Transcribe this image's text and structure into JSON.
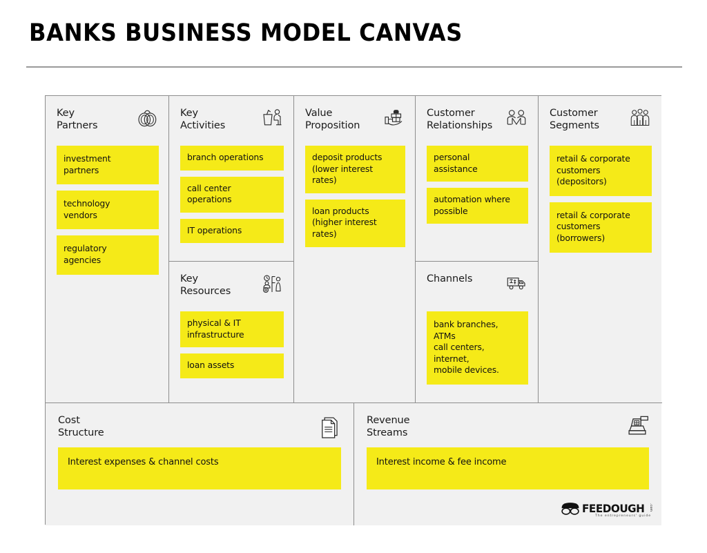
{
  "page": {
    "title": "BANKS BUSINESS MODEL CANVAS",
    "background_color": "#ffffff",
    "panel_color": "#f1f1f1",
    "note_color": "#F5EA18",
    "border_color": "#8d8d8d"
  },
  "blocks": {
    "key_partners": {
      "title": "Key\nPartners",
      "icon": "interlocking-rings-icon",
      "notes": [
        "investment\npartners",
        "technology\nvendors",
        "regulatory\nagencies"
      ]
    },
    "key_activities": {
      "title": "Key\nActivities",
      "icon": "person-at-desk-icon",
      "notes": [
        "branch operations",
        "call center\noperations",
        "IT operations"
      ]
    },
    "key_resources": {
      "title": "Key\nResources",
      "icon": "gears-clock-person-icon",
      "notes": [
        "physical & IT\ninfrastructure",
        "loan assets"
      ]
    },
    "value_proposition": {
      "title": "Value\nProposition",
      "icon": "gift-in-hand-icon",
      "notes": [
        "deposit products\n(lower interest rates)",
        "loan products\n(higher interest rates)"
      ]
    },
    "customer_relationships": {
      "title": "Customer\nRelationships",
      "icon": "two-people-handshake-icon",
      "notes": [
        "personal\nassistance",
        "automation where\npossible"
      ]
    },
    "channels": {
      "title": "Channels",
      "icon": "delivery-truck-icon",
      "notes": [
        "bank branches, ATMs\ncall centers, internet,\nmobile devices."
      ]
    },
    "customer_segments": {
      "title": "Customer\nSegments",
      "icon": "group-of-people-icon",
      "notes": [
        "retail & corporate\ncustomers\n(depositors)",
        "retail & corporate\ncustomers\n(borrowers)"
      ]
    },
    "cost_structure": {
      "title": "Cost\nStructure",
      "icon": "stacked-documents-icon",
      "notes": [
        "Interest expenses & channel costs"
      ]
    },
    "revenue_streams": {
      "title": "Revenue\nStreams",
      "icon": "cash-register-icon",
      "notes": [
        "Interest income & fee income"
      ]
    }
  },
  "logo": {
    "icon": "feedough-face-icon",
    "word": "FEEDOUGH",
    "dotcom": ".com",
    "tagline": "The entrepreneurs' guide"
  }
}
